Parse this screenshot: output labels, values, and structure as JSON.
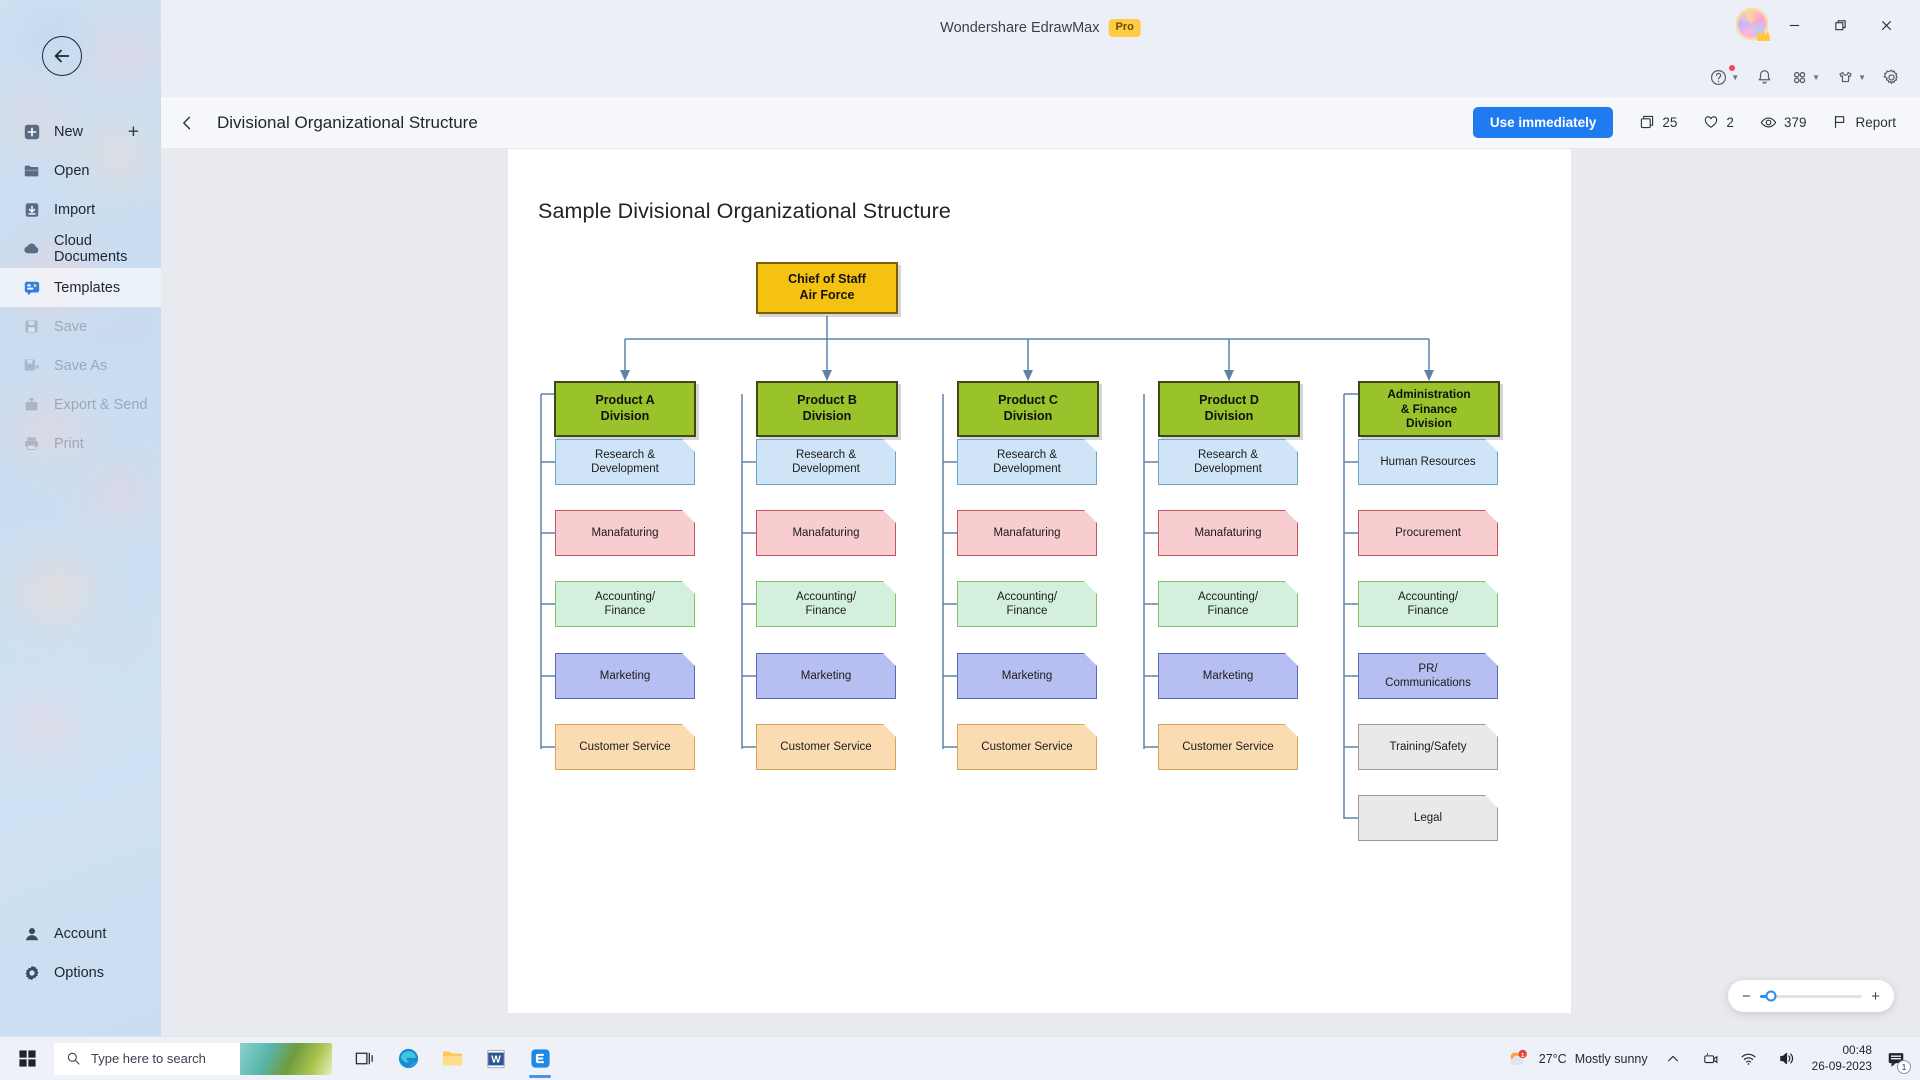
{
  "app": {
    "title": "Wondershare EdrawMax",
    "pro_badge": "Pro"
  },
  "window_controls": {
    "minimize": "minimize-icon",
    "restore": "restore-icon",
    "close": "close-icon"
  },
  "toolbar_icons": [
    {
      "name": "help-icon",
      "has_badge": true,
      "has_caret": true
    },
    {
      "name": "notification-bell-icon",
      "has_badge": false,
      "has_caret": false
    },
    {
      "name": "apps-grid-icon",
      "has_badge": false,
      "has_caret": true
    },
    {
      "name": "theme-shirt-icon",
      "has_badge": false,
      "has_caret": true
    },
    {
      "name": "settings-gear-icon",
      "has_badge": false,
      "has_caret": false
    }
  ],
  "sidebar": {
    "back_label": "Back",
    "items": [
      {
        "label": "New",
        "icon": "new-document-icon",
        "state": "enabled",
        "has_plus": true
      },
      {
        "label": "Open",
        "icon": "folder-icon",
        "state": "enabled"
      },
      {
        "label": "Import",
        "icon": "import-icon",
        "state": "enabled"
      },
      {
        "label": "Cloud Documents",
        "icon": "cloud-icon",
        "state": "enabled"
      },
      {
        "label": "Templates",
        "icon": "templates-icon",
        "state": "active"
      },
      {
        "label": "Save",
        "icon": "save-icon",
        "state": "disabled"
      },
      {
        "label": "Save As",
        "icon": "save-as-icon",
        "state": "disabled"
      },
      {
        "label": "Export & Send",
        "icon": "export-icon",
        "state": "disabled"
      },
      {
        "label": "Print",
        "icon": "print-icon",
        "state": "disabled"
      }
    ],
    "bottom_items": [
      {
        "label": "Account",
        "icon": "account-icon"
      },
      {
        "label": "Options",
        "icon": "options-gear-icon"
      }
    ]
  },
  "doc_header": {
    "title": "Divisional Organizational Structure",
    "back_icon": "chevron-left-icon",
    "use_button": "Use immediately",
    "stats": [
      {
        "name": "copies",
        "icon": "copy-icon",
        "value": "25"
      },
      {
        "name": "likes",
        "icon": "heart-icon",
        "value": "2"
      },
      {
        "name": "views",
        "icon": "eye-icon",
        "value": "379"
      },
      {
        "name": "report",
        "icon": "flag-icon",
        "value": "Report"
      }
    ]
  },
  "chart_data": {
    "type": "diagram",
    "title": "Sample Divisional Organizational Structure",
    "root": {
      "label": "Chief of Staff\nAir Force",
      "line1": "Chief of Staff",
      "line2": "Air Force",
      "fill": "#f5c211",
      "stroke": "#7a5f05"
    },
    "divisions": [
      {
        "line1": "Product A",
        "line2": "Division",
        "line3": "",
        "fill": "#9ac22a",
        "stroke": "#3e4a16",
        "children": [
          {
            "label": "Research &\nDevelopment",
            "line1": "Research &",
            "line2": "Development",
            "style": "leaf-blue"
          },
          {
            "label": "Manafaturing",
            "line1": "Manafaturing",
            "line2": "",
            "style": "leaf-pink"
          },
          {
            "label": "Accounting/\nFinance",
            "line1": "Accounting/",
            "line2": "Finance",
            "style": "leaf-green"
          },
          {
            "label": "Marketing",
            "line1": "Marketing",
            "line2": "",
            "style": "leaf-purple"
          },
          {
            "label": "Customer Service",
            "line1": "Customer Service",
            "line2": "",
            "style": "leaf-orange"
          }
        ]
      },
      {
        "line1": "Product B",
        "line2": "Division",
        "line3": "",
        "fill": "#9ac22a",
        "stroke": "#3e4a16",
        "children": [
          {
            "label": "Research &\nDevelopment",
            "line1": "Research &",
            "line2": "Development",
            "style": "leaf-blue"
          },
          {
            "label": "Manafaturing",
            "line1": "Manafaturing",
            "line2": "",
            "style": "leaf-pink"
          },
          {
            "label": "Accounting/\nFinance",
            "line1": "Accounting/",
            "line2": "Finance",
            "style": "leaf-green"
          },
          {
            "label": "Marketing",
            "line1": "Marketing",
            "line2": "",
            "style": "leaf-purple"
          },
          {
            "label": "Customer Service",
            "line1": "Customer Service",
            "line2": "",
            "style": "leaf-orange"
          }
        ]
      },
      {
        "line1": "Product C",
        "line2": "Division",
        "line3": "",
        "fill": "#9ac22a",
        "stroke": "#3e4a16",
        "children": [
          {
            "label": "Research &\nDevelopment",
            "line1": "Research &",
            "line2": "Development",
            "style": "leaf-blue"
          },
          {
            "label": "Manafaturing",
            "line1": "Manafaturing",
            "line2": "",
            "style": "leaf-pink"
          },
          {
            "label": "Accounting/\nFinance",
            "line1": "Accounting/",
            "line2": "Finance",
            "style": "leaf-green"
          },
          {
            "label": "Marketing",
            "line1": "Marketing",
            "line2": "",
            "style": "leaf-purple"
          },
          {
            "label": "Customer Service",
            "line1": "Customer Service",
            "line2": "",
            "style": "leaf-orange"
          }
        ]
      },
      {
        "line1": "Product D",
        "line2": "Division",
        "line3": "",
        "fill": "#9ac22a",
        "stroke": "#3e4a16",
        "children": [
          {
            "label": "Research &\nDevelopment",
            "line1": "Research &",
            "line2": "Development",
            "style": "leaf-blue"
          },
          {
            "label": "Manafaturing",
            "line1": "Manafaturing",
            "line2": "",
            "style": "leaf-pink"
          },
          {
            "label": "Accounting/\nFinance",
            "line1": "Accounting/",
            "line2": "Finance",
            "style": "leaf-green"
          },
          {
            "label": "Marketing",
            "line1": "Marketing",
            "line2": "",
            "style": "leaf-purple"
          },
          {
            "label": "Customer Service",
            "line1": "Customer Service",
            "line2": "",
            "style": "leaf-orange"
          }
        ]
      },
      {
        "line1": "Administration",
        "line2": "& Finance",
        "line3": "Division",
        "fill": "#9ac22a",
        "stroke": "#3e4a16",
        "children": [
          {
            "label": "Human Resources",
            "line1": "Human Resources",
            "line2": "",
            "style": "leaf-blue"
          },
          {
            "label": "Procurement",
            "line1": "Procurement",
            "line2": "",
            "style": "leaf-pink"
          },
          {
            "label": "Accounting/\nFinance",
            "line1": "Accounting/",
            "line2": "Finance",
            "style": "leaf-green"
          },
          {
            "label": "PR/\nCommunications",
            "line1": "PR/",
            "line2": "Communications",
            "style": "leaf-purple"
          },
          {
            "label": "Training/Safety",
            "line1": "Training/Safety",
            "line2": "",
            "style": "leaf-gray"
          },
          {
            "label": "Legal",
            "line1": "Legal",
            "line2": "",
            "style": "leaf-gray"
          }
        ]
      }
    ]
  },
  "zoom_control": {
    "minus": "−",
    "plus": "+"
  },
  "taskbar": {
    "start_icon": "windows-start-icon",
    "search_placeholder": "Type here to search",
    "search_icon": "search-icon",
    "apps": [
      {
        "name": "task-view-icon"
      },
      {
        "name": "microsoft-edge-icon"
      },
      {
        "name": "file-explorer-icon"
      },
      {
        "name": "microsoft-word-icon"
      },
      {
        "name": "edrawmax-icon"
      }
    ],
    "tray": {
      "weather_temp": "27°C",
      "weather_desc": "Mostly sunny",
      "chevron_icon": "chevron-up-icon",
      "icons": [
        "camera-icon",
        "wifi-icon",
        "volume-icon"
      ],
      "time": "00:48",
      "date": "26-09-2023",
      "notification_count": "1"
    }
  }
}
